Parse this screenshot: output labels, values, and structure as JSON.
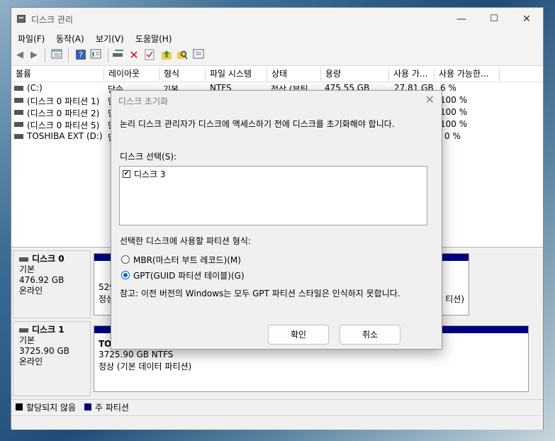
{
  "window": {
    "title": "디스크 관리",
    "minimize": "—",
    "maximize": "☐",
    "close": "✕"
  },
  "menu": [
    "파일(F)",
    "동작(A)",
    "보기(V)",
    "도움말(H)"
  ],
  "list": {
    "columns": [
      "볼륨",
      "레이아웃",
      "형식",
      "파일 시스템",
      "상태",
      "용량",
      "사용 가...",
      "사용 가능한..."
    ],
    "rows": [
      {
        "volume": "(C:)",
        "layout": "단순",
        "type": "기본",
        "fs": "NTFS",
        "status": "정상 (부팅,",
        "capacity": "475.55 GB",
        "free": "27.81 GB",
        "pct": "6 %"
      },
      {
        "volume": "(디스크 0 파티션 1)",
        "layout": "단",
        "pct": "100 %"
      },
      {
        "volume": "(디스크 0 파티션 2)",
        "layout": "단",
        "pct": "100 %"
      },
      {
        "volume": "(디스크 0 파티션 5)",
        "layout": "단",
        "pct": "100 %"
      },
      {
        "volume": "TOSHIBA EXT (D:)",
        "layout": "단",
        "pct": "0 %"
      }
    ]
  },
  "disks": [
    {
      "name": "디스크 0",
      "type": "기본",
      "size": "476.92 GB",
      "state": "온라인",
      "part_partial": "529",
      "part_state": "정상",
      "part_tail": "티션)"
    },
    {
      "name": "디스크 1",
      "type": "기본",
      "size": "3725.90 GB",
      "state": "온라인",
      "part_name": "TOS",
      "part_size": "3725.90 GB NTFS",
      "part_state": "정상 (기본 데이터 파티션)"
    }
  ],
  "legend": {
    "unallocated": "할당되지 않음",
    "primary": "주 파티션",
    "unallocated_color": "#000000",
    "primary_color": "#000080"
  },
  "dialog": {
    "title": "디스크 초기화",
    "message": "논리 디스크 관리자가 디스크에 액세스하기 전에 디스크를 초기화해야 합니다.",
    "select_label": "디스크 선택(S):",
    "disks": [
      {
        "label": "디스크 3",
        "checked": true
      }
    ],
    "partition_label": "선택한 디스크에 사용할 파티션 형식:",
    "options": [
      {
        "label": "MBR(마스터 부트 레코드)(M)",
        "selected": false
      },
      {
        "label": "GPT(GUID 파티션 테이블)(G)",
        "selected": true
      }
    ],
    "note": "참고: 이전 버전의 Windows는 모두 GPT 파티션 스타일은 인식하지 못합니다.",
    "ok": "확인",
    "cancel": "취소"
  }
}
